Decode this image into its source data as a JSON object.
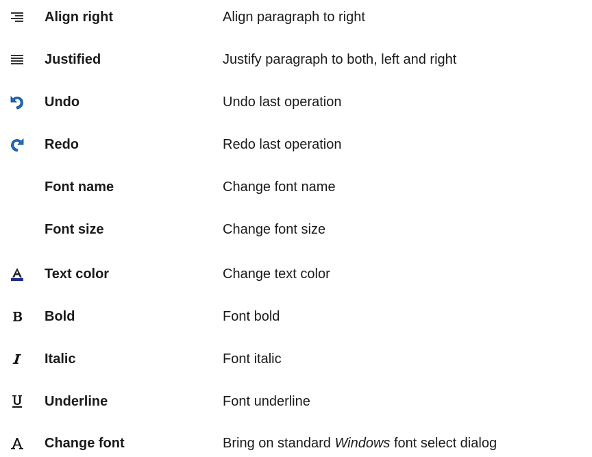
{
  "rows": [
    {
      "icon": "align-right-icon",
      "name": "Align right",
      "desc": "Align paragraph to right"
    },
    {
      "icon": "justify-icon",
      "name": "Justified",
      "desc": "Justify paragraph to both, left and right"
    },
    {
      "icon": "undo-icon",
      "name": "Undo",
      "desc": "Undo last operation"
    },
    {
      "icon": "redo-icon",
      "name": "Redo",
      "desc": "Redo last operation"
    },
    {
      "icon": "",
      "name": "Font name",
      "desc": "Change font name"
    },
    {
      "icon": "",
      "name": "Font size",
      "desc": "Change font size"
    },
    {
      "icon": "text-color-icon",
      "name": "Text color",
      "desc": "Change text color"
    },
    {
      "icon": "bold-icon",
      "name": "Bold",
      "desc": "Font bold"
    },
    {
      "icon": "italic-icon",
      "name": "Italic",
      "desc": "Font italic"
    },
    {
      "icon": "underline-icon",
      "name": "Underline",
      "desc": "Font underline"
    },
    {
      "icon": "change-font-icon",
      "name": "Change font",
      "desc_pre": "Bring on standard ",
      "desc_em": "Windows",
      "desc_post": " font select dialog"
    }
  ],
  "colors": {
    "text": "#1a1a1a",
    "icon_blue": "#1f6fc4",
    "icon_navy": "#1a2c8c",
    "icon_gray": "#444444"
  }
}
